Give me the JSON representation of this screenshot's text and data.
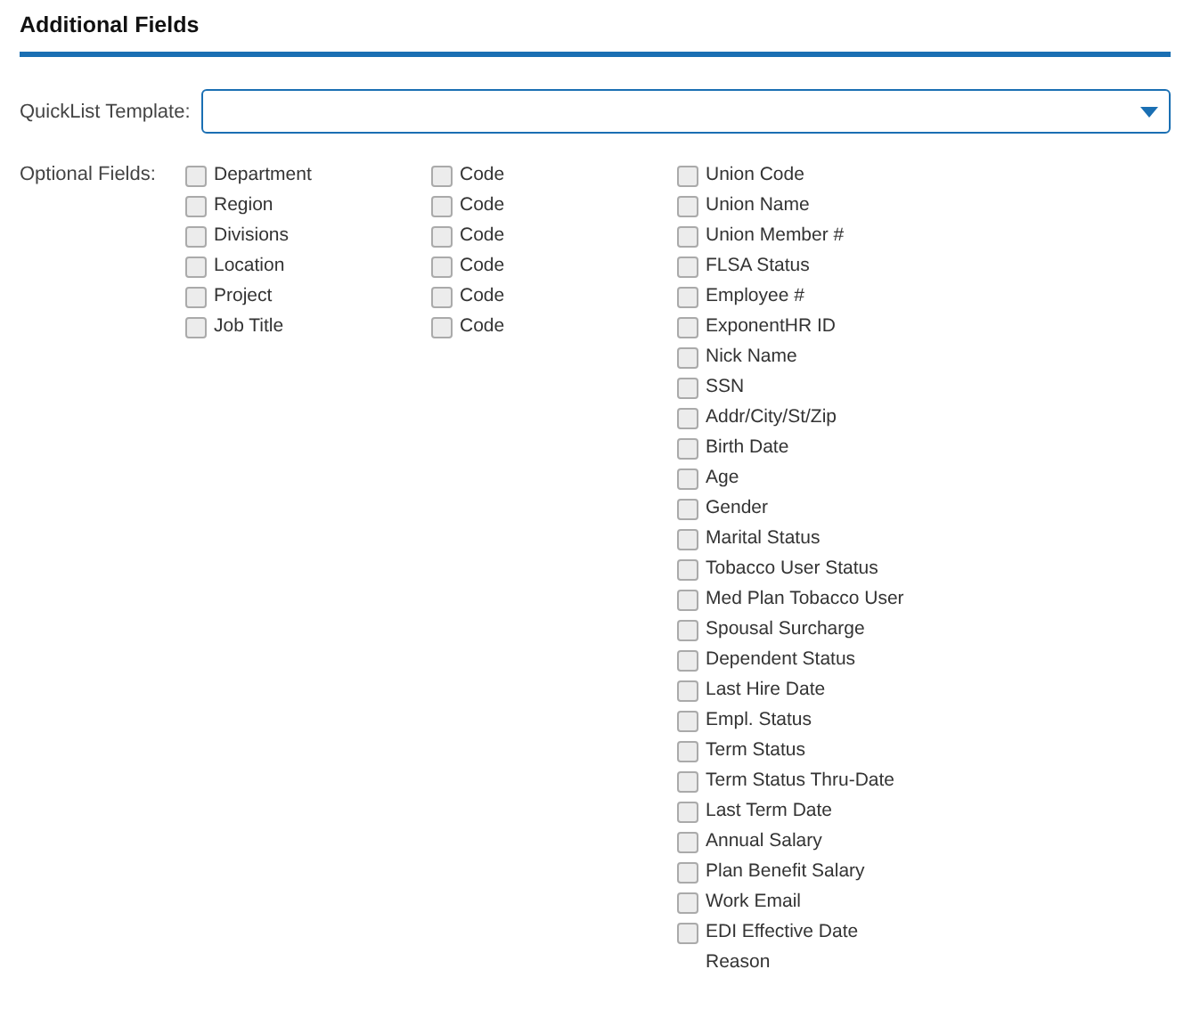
{
  "section": {
    "title": "Additional Fields"
  },
  "quicklist_template": {
    "label": "QuickList Template:"
  },
  "optional_fields": {
    "label": "Optional Fields:",
    "columns": [
      [
        {
          "label": "Department",
          "checked": false
        },
        {
          "label": "Region",
          "checked": false
        },
        {
          "label": "Divisions",
          "checked": false
        },
        {
          "label": "Location",
          "checked": false
        },
        {
          "label": "Project",
          "checked": false
        },
        {
          "label": "Job Title",
          "checked": false
        }
      ],
      [
        {
          "label": "Code",
          "checked": false
        },
        {
          "label": "Code",
          "checked": false
        },
        {
          "label": "Code",
          "checked": false
        },
        {
          "label": "Code",
          "checked": false
        },
        {
          "label": "Code",
          "checked": false
        },
        {
          "label": "Code",
          "checked": false
        }
      ],
      [
        {
          "label": "Union Code",
          "checked": false
        },
        {
          "label": "Union Name",
          "checked": false
        },
        {
          "label": "Union Member #",
          "checked": false
        },
        {
          "label": "FLSA Status",
          "checked": false
        },
        {
          "label": "Employee #",
          "checked": false
        },
        {
          "label": "ExponentHR ID",
          "checked": false
        },
        {
          "label": "Nick Name",
          "checked": false
        },
        {
          "label": "SSN",
          "checked": false
        },
        {
          "label": "Addr/City/St/Zip",
          "checked": false
        },
        {
          "label": "Birth Date",
          "checked": false
        },
        {
          "label": "Age",
          "checked": false
        },
        {
          "label": "Gender",
          "checked": false
        },
        {
          "label": "Marital Status",
          "checked": false
        },
        {
          "label": "Tobacco User Status",
          "checked": false
        },
        {
          "label": "Med Plan Tobacco User",
          "checked": false
        },
        {
          "label": "Spousal Surcharge",
          "checked": false
        },
        {
          "label": "Dependent Status",
          "checked": false
        },
        {
          "label": "Last Hire Date",
          "checked": false
        },
        {
          "label": "Empl. Status",
          "checked": false
        },
        {
          "label": "Term Status",
          "checked": false
        },
        {
          "label": "Term Status Thru-Date",
          "checked": false
        },
        {
          "label": "Last Term Date",
          "checked": false
        },
        {
          "label": "Annual Salary",
          "checked": false
        },
        {
          "label": "Plan Benefit Salary",
          "checked": false
        },
        {
          "label": "Work Email",
          "checked": false
        },
        {
          "label": "EDI Effective Date Reason",
          "checked": false
        }
      ]
    ]
  }
}
